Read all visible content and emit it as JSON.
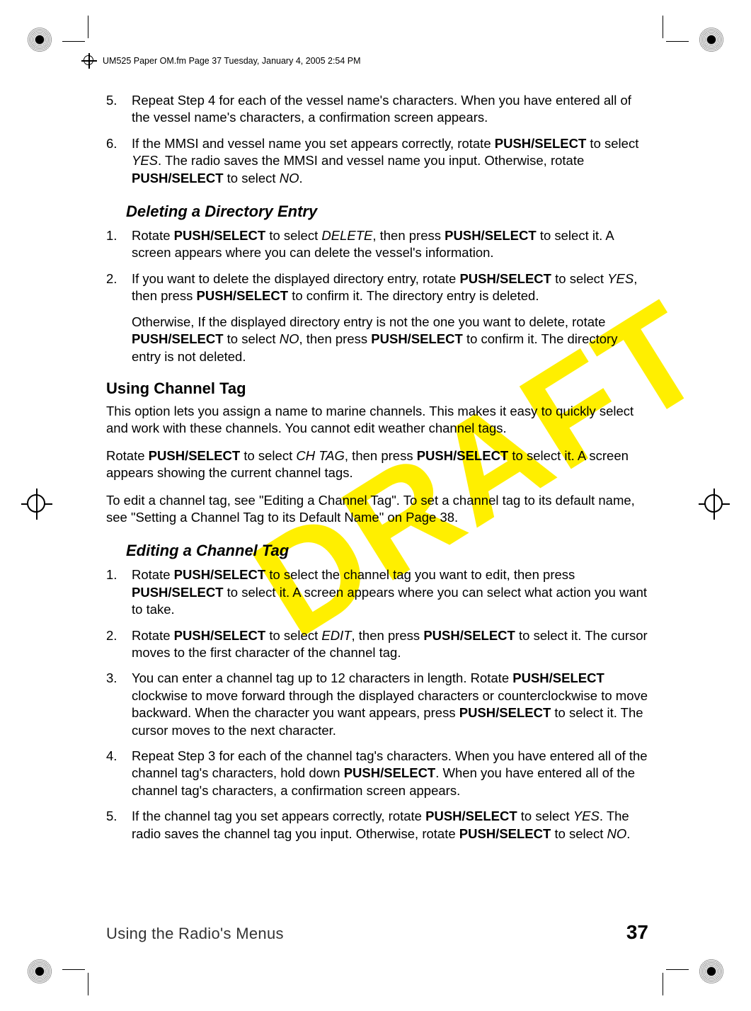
{
  "header": {
    "text": "UM525 Paper OM.fm  Page 37  Tuesday, January 4, 2005  2:54 PM"
  },
  "watermark": "DRAFT",
  "list1": {
    "item5": {
      "num": "5.",
      "text": "Repeat Step 4 for each of the vessel name's characters. When you have entered all of the vessel name's characters, a confirmation screen appears."
    },
    "item6": {
      "num": "6.",
      "pre": "If the MMSI and vessel name you set appears correctly, rotate ",
      "b1": "PUSH/SELECT",
      "mid1": " to select ",
      "i1": "YES",
      "mid2": ". The radio saves the MMSI and vessel name you input. Otherwise, rotate ",
      "b2": "PUSH/SELECT",
      "mid3": " to select ",
      "i2": "NO",
      "post": "."
    }
  },
  "subhead1": "Deleting a Directory Entry",
  "list2": {
    "item1": {
      "num": "1.",
      "pre": "Rotate ",
      "b1": "PUSH/SELECT",
      "mid1": " to select ",
      "i1": "DELETE",
      "mid2": ", then press ",
      "b2": "PUSH/SELECT",
      "post": " to select it. A screen appears where you can delete the vessel's information."
    },
    "item2": {
      "num": "2.",
      "p1": {
        "pre": "If you want to delete the displayed directory entry, rotate ",
        "b1": "PUSH/SELECT",
        "mid1": " to select ",
        "i1": "YES",
        "mid2": ", then press ",
        "b2": "PUSH/SELECT",
        "post": " to confirm it. The directory entry is deleted."
      },
      "p2": {
        "pre": "Otherwise, If the displayed directory entry is not the one you want to delete, rotate ",
        "b1": "PUSH/SELECT",
        "mid1": " to select ",
        "i1": "NO",
        "mid2": ", then press ",
        "b2": "PUSH/SELECT",
        "post": " to confirm it. The directory entry is not deleted."
      }
    }
  },
  "h2_1": "Using Channel Tag",
  "para1": "This option lets you assign a name to marine channels. This makes it easy to quickly select and work with these channels. You cannot edit weather channel tags.",
  "para2": {
    "pre": "Rotate ",
    "b1": "PUSH/SELECT",
    "mid1": " to select ",
    "i1": "CH TAG",
    "mid2": ", then press ",
    "b2": "PUSH/SELECT",
    "post": " to select it. A screen appears showing the current channel tags."
  },
  "para3": "To edit a channel tag, see \"Editing a Channel Tag\". To set a channel tag to its default name, see \"Setting a Channel Tag to its Default Name\" on Page 38.",
  "subhead2": "Editing a Channel Tag",
  "list3": {
    "item1": {
      "num": "1.",
      "pre": "Rotate ",
      "b1": "PUSH/SELECT",
      "mid1": " to select the channel tag you want to edit, then press ",
      "b2": "PUSH/SELECT",
      "post": " to select it. A screen appears where you can select what action you want to take."
    },
    "item2": {
      "num": "2.",
      "pre": "Rotate ",
      "b1": "PUSH/SELECT",
      "mid1": " to select ",
      "i1": "EDIT",
      "mid2": ", then press ",
      "b2": "PUSH/SELECT",
      "post": " to select it. The cursor moves to the first character of the channel tag."
    },
    "item3": {
      "num": "3.",
      "pre": "You can enter a channel tag up to 12 characters in length. Rotate ",
      "b1": "PUSH/SELECT",
      "mid1": " clockwise to move forward through the displayed characters or counterclockwise to move backward. When the character you want appears, press ",
      "b2": "PUSH/SELECT",
      "post": " to select it. The cursor moves to the next character."
    },
    "item4": {
      "num": "4.",
      "pre": "Repeat Step 3 for each of the channel tag's characters. When you have entered all of the channel tag's characters, hold down ",
      "b1": "PUSH/SELECT",
      "post": ". When you have entered all of the channel tag's characters, a confirmation screen appears."
    },
    "item5": {
      "num": "5.",
      "pre": "If the channel tag you set appears correctly, rotate ",
      "b1": "PUSH/SELECT",
      "mid1": " to select ",
      "i1": "YES",
      "mid2": ". The radio saves the channel tag you input. Otherwise, rotate ",
      "b2": "PUSH/SELECT",
      "mid3": " to select ",
      "i2": "NO",
      "post": "."
    }
  },
  "footer": {
    "title": "Using the Radio's Menus",
    "page": "37"
  }
}
